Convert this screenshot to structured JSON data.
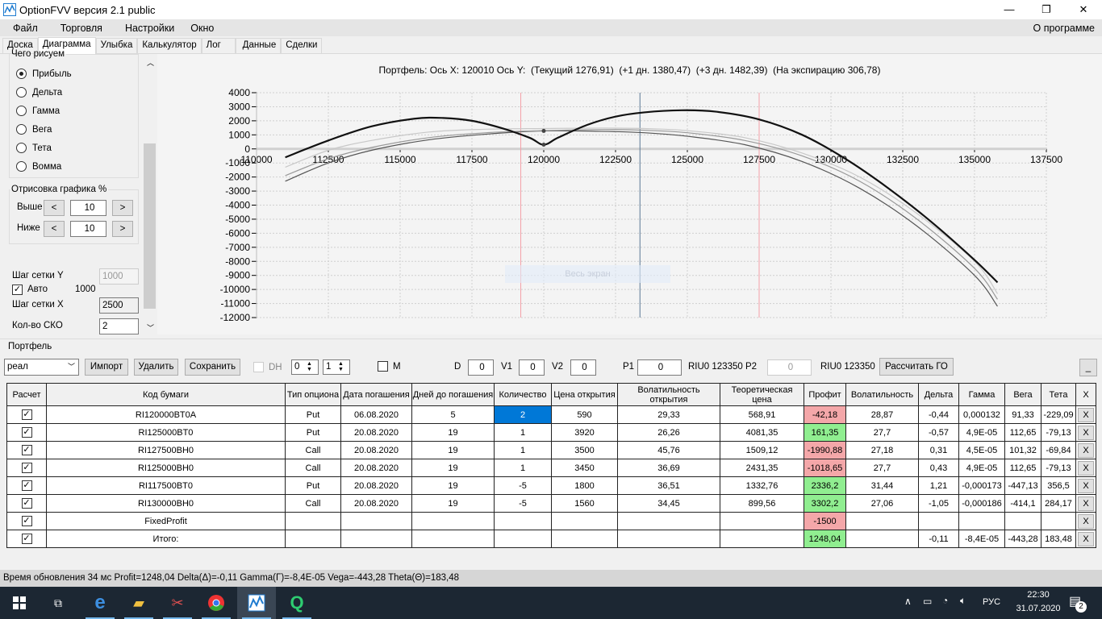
{
  "window": {
    "title": "OptionFVV версия 2.1 public",
    "minimize": "—",
    "maximize": "❐",
    "close": "✕"
  },
  "menu": {
    "items": [
      "Файл",
      "Торговля",
      "Настройки",
      "Окно"
    ],
    "about": "О программе"
  },
  "tabs": [
    "Доска",
    "Диаграмма",
    "Улыбка",
    "Калькулятор",
    "Лог",
    "Данные",
    "Сделки"
  ],
  "left": {
    "what_title": "Чего рисуем",
    "radios": [
      "Прибыль",
      "Дельта",
      "Гамма",
      "Вега",
      "Тета",
      "Вомма"
    ],
    "draw_title": "Отрисовка графика %",
    "above_label": "Выше",
    "above_value": "10",
    "below_label": "Ниже",
    "below_value": "10",
    "prev": "<",
    "next": ">",
    "grid_y_label": "Шаг сетки Y",
    "grid_y_value": "1000",
    "auto_label": "Авто",
    "auto_value": "1000",
    "grid_x_label": "Шаг сетки X",
    "grid_x_value": "2500",
    "sko_label": "Кол-во СКО",
    "sko_value": "2"
  },
  "chart_data": {
    "type": "line",
    "title": "Портфель: Ось X: 120010 Ось Y:  (Текущий 1276,91)  (+1 дн. 1380,47)  (+3 дн. 1482,39)  (На экспирацию 306,78)",
    "xlim": [
      110000,
      137500
    ],
    "ylim": [
      -12000,
      4000
    ],
    "xticks": [
      "110000",
      "112500",
      "115000",
      "117500",
      "120000",
      "122500",
      "125000",
      "127500",
      "130000",
      "132500",
      "135000",
      "137500"
    ],
    "yticks": [
      "4000",
      "3000",
      "2000",
      "1000",
      "0",
      "-1000",
      "-2000",
      "-3000",
      "-4000",
      "-5000",
      "-6000",
      "-7000",
      "-8000",
      "-9000",
      "-10000",
      "-11000",
      "-12000"
    ],
    "grid": true,
    "vlines": [
      {
        "x": 119200,
        "color": "#f4a0a8"
      },
      {
        "x": 123350,
        "color": "#5a7896"
      },
      {
        "x": 127500,
        "color": "#f4a0a8"
      }
    ],
    "overlay_button": "Весь экран",
    "series": [
      {
        "name": "На экспирацию",
        "color": "#111111",
        "width": 2.2,
        "points": [
          [
            111000,
            -600
          ],
          [
            112500,
            600
          ],
          [
            114000,
            1600
          ],
          [
            115500,
            2150
          ],
          [
            116500,
            2200
          ],
          [
            117500,
            2000
          ],
          [
            118500,
            1500
          ],
          [
            119500,
            800
          ],
          [
            120000,
            300
          ],
          [
            120500,
            800
          ],
          [
            121500,
            1700
          ],
          [
            122500,
            2300
          ],
          [
            123500,
            2600
          ],
          [
            124800,
            2750
          ],
          [
            126000,
            2650
          ],
          [
            127500,
            2100
          ],
          [
            129000,
            1000
          ],
          [
            130500,
            -700
          ],
          [
            132000,
            -2800
          ],
          [
            133500,
            -5200
          ],
          [
            135000,
            -7900
          ],
          [
            135800,
            -9500
          ]
        ]
      },
      {
        "name": "+3 дн.",
        "color": "#c8c8c8",
        "width": 1.2,
        "points": [
          [
            111000,
            -1300
          ],
          [
            112500,
            -100
          ],
          [
            114000,
            600
          ],
          [
            116000,
            1200
          ],
          [
            118000,
            1400
          ],
          [
            120000,
            1450
          ],
          [
            122000,
            1480
          ],
          [
            123500,
            1450
          ],
          [
            125000,
            1300
          ],
          [
            127000,
            800
          ],
          [
            129000,
            -300
          ],
          [
            131000,
            -2000
          ],
          [
            133000,
            -4600
          ],
          [
            135000,
            -8000
          ],
          [
            135800,
            -10300
          ]
        ]
      },
      {
        "name": "+1 дн.",
        "color": "#999999",
        "width": 1.2,
        "points": [
          [
            111000,
            -1900
          ],
          [
            112500,
            -700
          ],
          [
            114000,
            100
          ],
          [
            116000,
            800
          ],
          [
            118000,
            1150
          ],
          [
            120000,
            1300
          ],
          [
            122000,
            1380
          ],
          [
            123500,
            1330
          ],
          [
            125000,
            1150
          ],
          [
            127000,
            600
          ],
          [
            129000,
            -500
          ],
          [
            131000,
            -2300
          ],
          [
            133000,
            -5000
          ],
          [
            135000,
            -8500
          ],
          [
            135800,
            -10700
          ]
        ]
      },
      {
        "name": "Текущий",
        "color": "#555555",
        "width": 1.2,
        "points": [
          [
            111000,
            -2300
          ],
          [
            112500,
            -1000
          ],
          [
            114000,
            -100
          ],
          [
            116000,
            650
          ],
          [
            118000,
            1050
          ],
          [
            120000,
            1280
          ],
          [
            122000,
            1250
          ],
          [
            123500,
            1150
          ],
          [
            125000,
            900
          ],
          [
            127000,
            300
          ],
          [
            129000,
            -900
          ],
          [
            131000,
            -2800
          ],
          [
            133000,
            -5500
          ],
          [
            135000,
            -9000
          ],
          [
            135800,
            -11200
          ]
        ]
      }
    ],
    "markers": [
      [
        120000,
        300
      ],
      [
        120000,
        1280
      ]
    ]
  },
  "portfolio": {
    "title": "Портфель",
    "select": "реал",
    "import": "Импорт",
    "delete": "Удалить",
    "save": "Сохранить",
    "dh": "DH",
    "spin1": "0",
    "spin2": "1",
    "m": "M",
    "d_label": "D",
    "d_value": "0",
    "v1_label": "V1",
    "v1_value": "0",
    "v2_label": "V2",
    "v2_value": "0",
    "p1_label": "P1",
    "p1_value": "0",
    "riu1": "RIU0 123350",
    "p2_label": "P2",
    "p2_value": "0",
    "riu2": "RIU0 123350",
    "calc_go": "Рассчитать ГО",
    "minimize": "_"
  },
  "table": {
    "headers": [
      "Расчет",
      "Код бумаги",
      "Тип опциона",
      "Дата погашения",
      "Дней до погашения",
      "Количество",
      "Цена открытия",
      "Волатильность открытия",
      "Теоретическая цена",
      "Профит",
      "Волатильность",
      "Дельта",
      "Гамма",
      "Вега",
      "Тета",
      "X"
    ],
    "rows": [
      [
        "RI120000BT0A",
        "Put",
        "06.08.2020",
        "5",
        "2",
        "590",
        "29,33",
        "568,91",
        "-42,18",
        "28,87",
        "-0,44",
        "0,000132",
        "91,33",
        "-229,09"
      ],
      [
        "RI125000BT0",
        "Put",
        "20.08.2020",
        "19",
        "1",
        "3920",
        "26,26",
        "4081,35",
        "161,35",
        "27,7",
        "-0,57",
        "4,9E-05",
        "112,65",
        "-79,13"
      ],
      [
        "RI127500BH0",
        "Call",
        "20.08.2020",
        "19",
        "1",
        "3500",
        "45,76",
        "1509,12",
        "-1990,88",
        "27,18",
        "0,31",
        "4,5E-05",
        "101,32",
        "-69,84"
      ],
      [
        "RI125000BH0",
        "Call",
        "20.08.2020",
        "19",
        "1",
        "3450",
        "36,69",
        "2431,35",
        "-1018,65",
        "27,7",
        "0,43",
        "4,9E-05",
        "112,65",
        "-79,13"
      ],
      [
        "RI117500BT0",
        "Put",
        "20.08.2020",
        "19",
        "-5",
        "1800",
        "36,51",
        "1332,76",
        "2336,2",
        "31,44",
        "1,21",
        "-0,000173",
        "-447,13",
        "356,5"
      ],
      [
        "RI130000BH0",
        "Call",
        "20.08.2020",
        "19",
        "-5",
        "1560",
        "34,45",
        "899,56",
        "3302,2",
        "27,06",
        "-1,05",
        "-0,000186",
        "-414,1",
        "284,17"
      ],
      [
        "FixedProfit",
        "",
        "",
        "",
        "",
        "",
        "",
        "",
        "-1500",
        "",
        "",
        "",
        "",
        ""
      ],
      [
        "Итого:",
        "",
        "",
        "",
        "",
        "",
        "",
        "",
        "1248,04",
        "",
        "-0,11",
        "-8,4E-05",
        "-443,28",
        "183,48"
      ]
    ],
    "check": "✓",
    "x": "X"
  },
  "status": "Время обновления 34 мс  Profit=1248,04 Delta(Δ)=-0,11 Gamma(Γ)=-8,4E-05 Vega=-443,28 Theta(Θ)=183,48",
  "taskbar": {
    "lang": "РУС",
    "time": "22:30",
    "date": "31.07.2020",
    "notif": "2"
  }
}
